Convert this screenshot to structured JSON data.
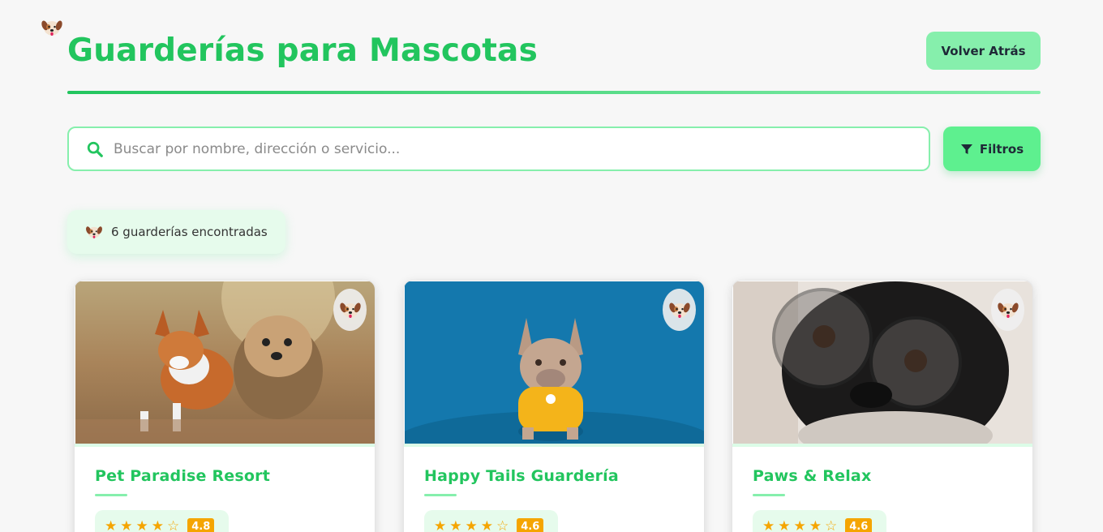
{
  "header": {
    "title": "Guarderías para Mascotas",
    "back_label": "Volver Atrás"
  },
  "search": {
    "placeholder": "Buscar por nombre, dirección o servicio...",
    "value": ""
  },
  "filters": {
    "label": "Filtros"
  },
  "results": {
    "count_text": "6 guarderías encontradas"
  },
  "cards": [
    {
      "name": "Pet Paradise Resort",
      "rating": "4.8",
      "stars": 4.5
    },
    {
      "name": "Happy Tails Guardería",
      "rating": "4.6",
      "stars": 4.5
    },
    {
      "name": "Paws & Relax",
      "rating": "4.6",
      "stars": 4.5
    }
  ],
  "icons": {
    "logo": "dog-face-icon",
    "search": "search-icon",
    "filter": "filter-icon",
    "star": "star-icon",
    "half_star": "half-star-icon"
  },
  "colors": {
    "brand": "#22c55e",
    "accent_light": "#86efac",
    "filter_button": "#5ef08f",
    "star": "#f5a500",
    "badge_bg": "#e6fbec"
  }
}
